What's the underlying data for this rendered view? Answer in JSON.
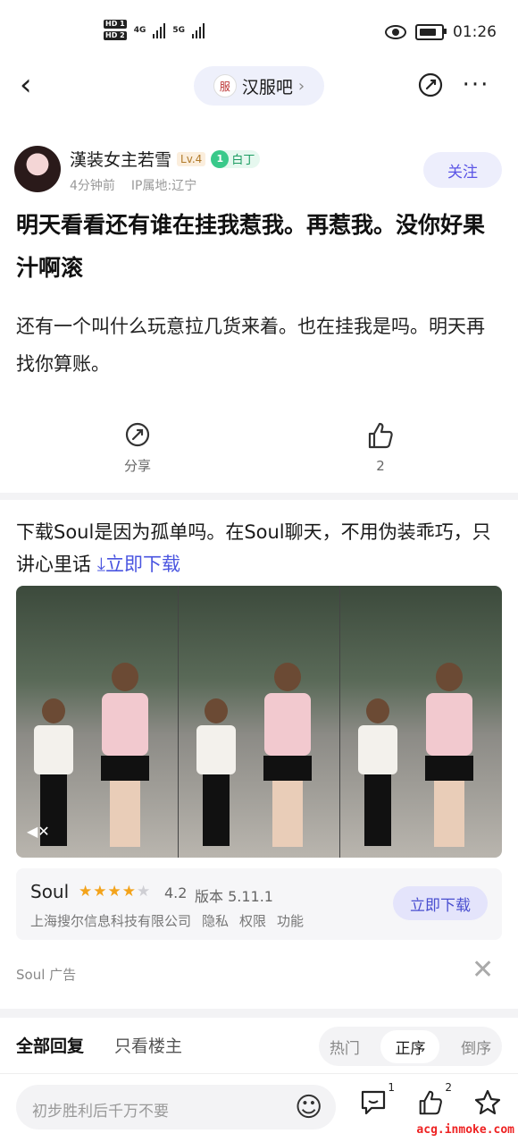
{
  "status_bar": {
    "sim1": "HD 1",
    "sim2": "HD 2",
    "net1": "4G",
    "net2": "5G",
    "time": "01:26"
  },
  "nav": {
    "forum_name": "汉服吧",
    "icons": [
      "back-arrow-icon",
      "edit-share-icon",
      "more-dots-icon"
    ]
  },
  "post": {
    "author": "漢装女主若雪",
    "level": "Lv.4",
    "badge_num": "1",
    "badge_label": "白丁",
    "time_ago": "4分钟前",
    "ip": "IP属地:辽宁",
    "follow_label": "关注",
    "title": "明天看看还有谁在挂我惹我。再惹我。没你好果汁啊滚",
    "body": "还有一个叫什么玩意拉几货来着。也在挂我是吗。明天再找你算账。",
    "share_label": "分享",
    "like_count": "2"
  },
  "ad": {
    "text": "下载Soul是因为孤单吗。在Soul聊天，不用伪装乖巧，只讲心里话",
    "download_link": "立即下载",
    "app_name": "Soul",
    "stars_on": 4,
    "rating": "4.2",
    "version": "版本 5.11.1",
    "company": "上海搜尔信息科技有限公司",
    "privacy": "隐私",
    "permission": "权限",
    "feature": "功能",
    "download_button": "立即下载",
    "source": "Soul  广告"
  },
  "replies": {
    "tab_all": "全部回复",
    "tab_op": "只看楼主",
    "sort_hot": "热门",
    "sort_asc": "正序",
    "sort_desc": "倒序"
  },
  "bottom": {
    "placeholder": "初步胜利后千万不要",
    "comment_count": "1",
    "like_count": "2"
  },
  "watermark": "acg.inmoke.com",
  "colors": {
    "accent": "#5b55e6",
    "link": "#4a55e0",
    "star": "#f3a31b",
    "badge_green": "#39c98a"
  }
}
